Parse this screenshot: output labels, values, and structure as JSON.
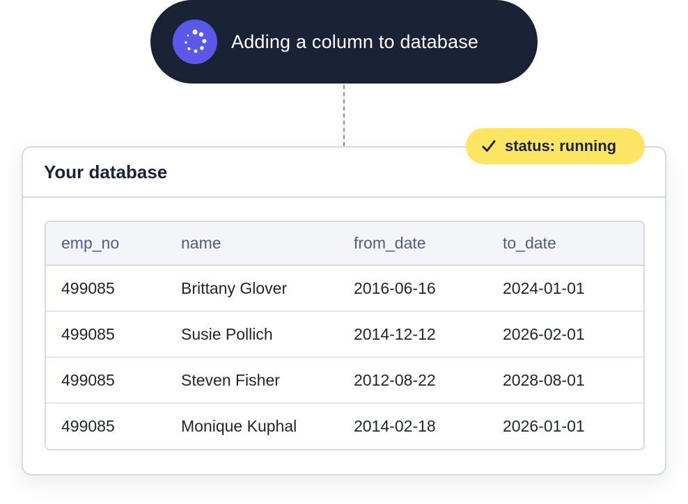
{
  "toast": {
    "icon": "spinner-icon",
    "text": "Adding a column to database",
    "background": "#1a2235",
    "icon_background": "#5b57e8"
  },
  "status_badge": {
    "icon": "check-icon",
    "text": "status: running",
    "background": "#fce563"
  },
  "card": {
    "title": "Your database"
  },
  "table": {
    "columns": [
      "emp_no",
      "name",
      "from_date",
      "to_date"
    ],
    "rows": [
      [
        "499085",
        "Brittany Glover",
        "2016-06-16",
        "2024-01-01"
      ],
      [
        "499085",
        "Susie Pollich",
        "2014-12-12",
        "2026-02-01"
      ],
      [
        "499085",
        "Steven Fisher",
        "2012-08-22",
        "2028-08-01"
      ],
      [
        "499085",
        "Monique Kuphal",
        "2014-02-18",
        "2026-01-01"
      ]
    ]
  }
}
